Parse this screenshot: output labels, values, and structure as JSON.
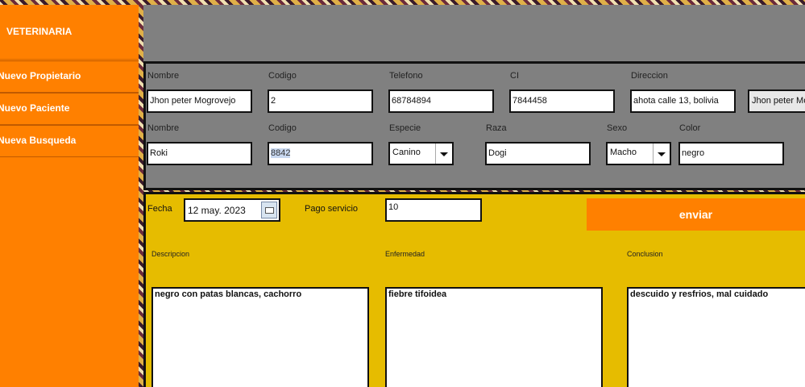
{
  "app": {
    "title": "VETERINARIA"
  },
  "sidebar": {
    "items": [
      {
        "label": "Nuevo Propietario"
      },
      {
        "label": "Nuevo Paciente"
      },
      {
        "label": "Nueva Busqueda"
      }
    ]
  },
  "owner": {
    "labels": {
      "nombre": "Nombre",
      "codigo": "Codigo",
      "telefono": "Telefono",
      "ci": "CI",
      "direccion": "Direccion"
    },
    "values": {
      "nombre": "Jhon peter Mogrovejo",
      "codigo": "2",
      "telefono": "68784894",
      "ci": "7844458",
      "direccion": "ahota calle 13, bolivia"
    },
    "selected_owner": "Jhon peter Mogrovejo"
  },
  "patient": {
    "labels": {
      "nombre": "Nombre",
      "codigo": "Codigo",
      "especie": "Especie",
      "raza": "Raza",
      "sexo": "Sexo",
      "color": "Color"
    },
    "values": {
      "nombre": "Roki",
      "codigo": "8842",
      "especie": "Canino",
      "raza": "Dogi",
      "sexo": "Macho",
      "color": "negro"
    }
  },
  "visit": {
    "labels": {
      "fecha": "Fecha",
      "pago": "Pago servicio",
      "descripcion": "Descripcion",
      "enfermedad": "Enfermedad",
      "conclusion": "Conclusion"
    },
    "values": {
      "fecha": "12 may. 2023",
      "pago": "10",
      "descripcion": "negro con patas blancas, cachorro",
      "enfermedad": "fiebre tifoidea",
      "conclusion": "descuido y resfrios, mal cuidado"
    },
    "submit_label": "enviar"
  },
  "colors": {
    "accent": "#ff8000",
    "panel_gray": "#808080",
    "panel_yellow": "#e6bc00"
  }
}
